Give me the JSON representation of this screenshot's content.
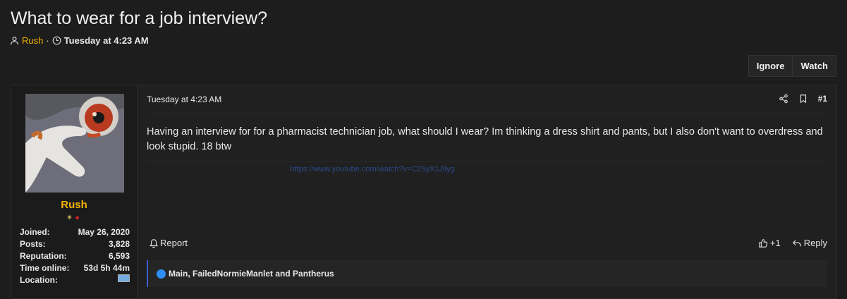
{
  "thread": {
    "title": "What to wear for a job interview?",
    "author": "Rush",
    "separator": "·",
    "date": "Tuesday at 4:23 AM"
  },
  "buttons": {
    "ignore": "Ignore",
    "watch": "Watch"
  },
  "user": {
    "name": "Rush",
    "stats": [
      {
        "label": "Joined:",
        "value": "May 26, 2020"
      },
      {
        "label": "Posts:",
        "value": "3,828"
      },
      {
        "label": "Reputation:",
        "value": "6,593"
      },
      {
        "label": "Time online:",
        "value": "53d 5h 44m"
      },
      {
        "label": "Location:",
        "value": ""
      }
    ]
  },
  "post": {
    "time": "Tuesday at 4:23 AM",
    "number": "#1",
    "body": "Having an interview for for a pharmacist technician job, what should I wear? Im thinking a dress shirt and pants, but I also don't want to overdress and look stupid. 18 btw",
    "link": "https://www.youtube.com/watch?v=C25yX1Jliyg",
    "report": "Report",
    "like": "+1",
    "reply": "Reply",
    "reactions": "Main, FailedNormieManlet and Pantherus"
  },
  "colors": {
    "accent": "#f5b301",
    "link": "#2a4a8a",
    "reaction": "#2e8ef5"
  }
}
